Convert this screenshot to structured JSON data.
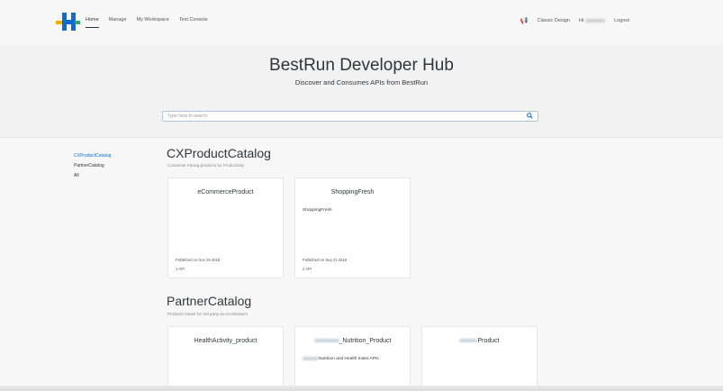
{
  "nav": {
    "items": [
      "Home",
      "Manage",
      "My Workspace",
      "Test Console"
    ],
    "active": "Home"
  },
  "right_nav": {
    "classic": "Classic Design",
    "greeting": "Hi",
    "logout": "Logout"
  },
  "hero": {
    "title": "BestRun Developer Hub",
    "subtitle": "Discover and Consumes APIs from BestRun",
    "search_placeholder": "Type here to search"
  },
  "sidebar": {
    "items": [
      "CXProductCatalog",
      "PartnerCatalog",
      "All"
    ]
  },
  "sections": [
    {
      "title": "CXProductCatalog",
      "subtitle": "Consumer Facing products for Productivity",
      "cards": [
        {
          "title": "eCommerceProduct",
          "description": "",
          "published": "Published on Nov 26 2018",
          "apis": "1 API"
        },
        {
          "title": "ShoppingFresh",
          "description": "ShoppingFresh",
          "published": "Published on Sep 21 2018",
          "apis": "2 API"
        }
      ]
    },
    {
      "title": "PartnerCatalog",
      "subtitle": "Products meant for 3rd party as Accelerators",
      "cards": [
        {
          "title": "HealthActivity_product",
          "description": ""
        },
        {
          "title": "_Nutrition_Product",
          "description": "Nutrition and Health Index APIs"
        },
        {
          "title": "Product",
          "description": ""
        }
      ]
    }
  ],
  "colors": {
    "accent": "#0a6ed1",
    "text": "#32363a",
    "background": "#f7f7f7"
  }
}
